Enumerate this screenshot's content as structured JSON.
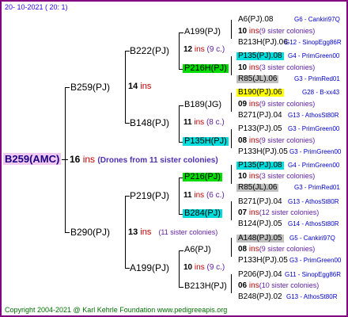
{
  "date": "20- 10-2021 ( 20: 1)",
  "root": {
    "name": "B259(AMC)",
    "ins_num": "16",
    "ins": "ins",
    "note": "(Drones from 11 sister colonies)"
  },
  "gen1": [
    {
      "name": "B259(PJ)",
      "ins_num": "14",
      "ins": "ins"
    },
    {
      "name": "B290(PJ)",
      "ins_num": "13",
      "ins": "ins",
      "note": "(11 sister colonies)"
    }
  ],
  "gen2": [
    {
      "name": "B222(PJ)",
      "ins_num": "12",
      "ins": "ins",
      "note": "(9 c.)"
    },
    {
      "name": "B148(PJ)",
      "ins_num": "11",
      "ins": "ins",
      "note": "(8 c.)"
    },
    {
      "name": "P219(PJ)",
      "ins_num": "11",
      "ins": "ins",
      "note": "(6 c.)"
    },
    {
      "name": "A199(PJ)",
      "ins_num": "10",
      "ins": "ins",
      "note": "(9 c.)"
    }
  ],
  "gen3": [
    {
      "name": "A199(PJ)"
    },
    {
      "name": "P216H(PJ)"
    },
    {
      "name": "B189(JG)"
    },
    {
      "name": "P135H(PJ)"
    },
    {
      "name": "P216(PJ)"
    },
    {
      "name": "B284(PJ)"
    },
    {
      "name": "A6(PJ)"
    },
    {
      "name": "B213H(PJ)"
    }
  ],
  "gen4": [
    {
      "a": "A6(PJ).08",
      "a_code": "G6 - Cankiri97Q",
      "m": "10",
      "ins": "ins",
      "note": "(9 sister colonies)",
      "b": "B213H(PJ).06",
      "b_code": "G12 - SinopEgg86R"
    },
    {
      "a": "P135(PJ).08",
      "a_code": "G4 - PrimGreen00",
      "m": "10",
      "ins": "ins",
      "note": "(3 sister colonies)",
      "b": "R85(JL).06",
      "b_code": "G3 - PrimRed01"
    },
    {
      "a": "B190(PJ).06",
      "a_code": "G28 - B-xx43",
      "m": "09",
      "ins": "ins",
      "note": "(9 sister colonies)",
      "b": "B271(PJ).04",
      "b_code": "G13 - AthosSt80R"
    },
    {
      "a": "P133(PJ).05",
      "a_code": "G3 - PrimGreen00",
      "m": "08",
      "ins": "ins",
      "note": "(9 sister colonies)",
      "b": "P133H(PJ).05",
      "b_code": "G3 - PrimGreen00"
    },
    {
      "a": "P135(PJ).08",
      "a_code": "G4 - PrimGreen00",
      "m": "10",
      "ins": "ins",
      "note": "(3 sister colonies)",
      "b": "R85(JL).06",
      "b_code": "G3 - PrimRed01"
    },
    {
      "a": "B271(PJ).04",
      "a_code": "G13 - AthosSt80R",
      "m": "07",
      "ins": "ins",
      "note": "(12 sister colonies)",
      "b": "B124(PJ).05",
      "b_code": "G14 - AthosSt80R"
    },
    {
      "a": "A148(PJ).05",
      "a_code": "G5 - Cankiri97Q",
      "m": "08",
      "ins": "ins",
      "note": "(9 sister colonies)",
      "b": "P133H(PJ).05",
      "b_code": "G3 - PrimGreen00"
    },
    {
      "a": "P206(PJ).04",
      "a_code": "G11 - SinopEgg86R",
      "m": "06",
      "ins": "ins",
      "note": "(10 sister colonies)",
      "b": "B248(PJ).02",
      "b_code": "G13 - AthosSt80R"
    }
  ],
  "footer": "Copyright 2004-2021 @ Karl Kehrle Foundation    www.pedigreeapis.org"
}
